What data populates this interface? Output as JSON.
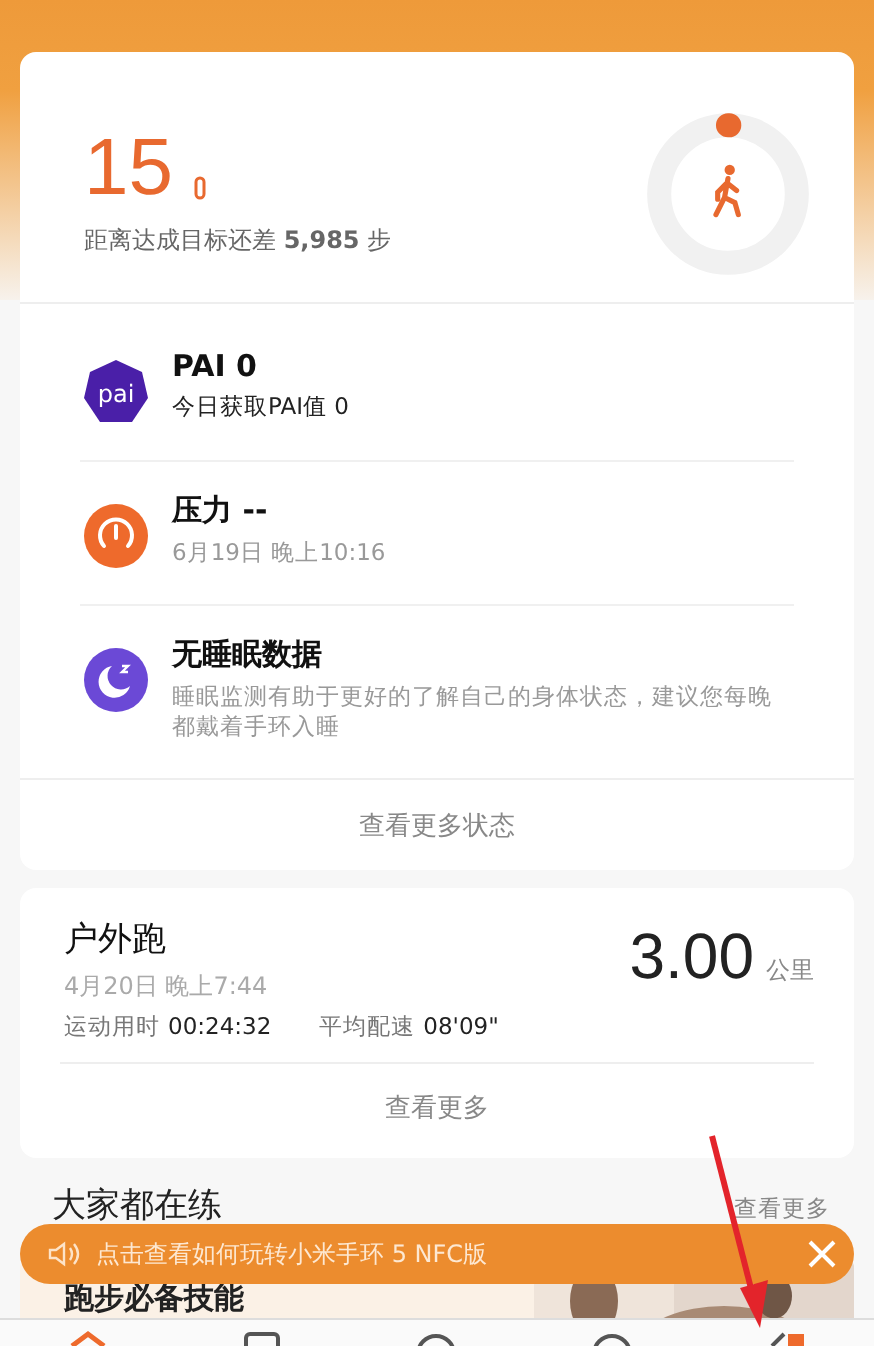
{
  "steps": {
    "value": "15",
    "goal_text": "距离达成目标还差 **5,985** 步",
    "level": 0.003
  },
  "status_items": [
    {
      "kind": "pai",
      "title": "PAI 0",
      "subtitle": "今日获取PAI值 0"
    },
    {
      "kind": "stress",
      "title": "压力 --",
      "subtitle": "6月19日 晚上10:16"
    },
    {
      "kind": "sleep",
      "title": "无睡眠数据",
      "subtitle": "睡眠监测有助于更好的了解自己的身体状态，建议您每晚都戴着手环入睡"
    }
  ],
  "more_status": "查看更多状态",
  "workout": {
    "title": "户外跑",
    "date": "4月20日 晚上7:44",
    "duration_label": "运动用时",
    "duration": "00:24:32",
    "pace_label": "平均配速",
    "pace": "08'09\"",
    "distance": "3.00",
    "unit": "公里",
    "more": "查看更多"
  },
  "section": {
    "title": "大家都在练",
    "more": "查看更多"
  },
  "banner": {
    "text": "点击查看如何玩转小米手环 5 NFC版"
  },
  "course": {
    "title": "跑步必备技能"
  }
}
